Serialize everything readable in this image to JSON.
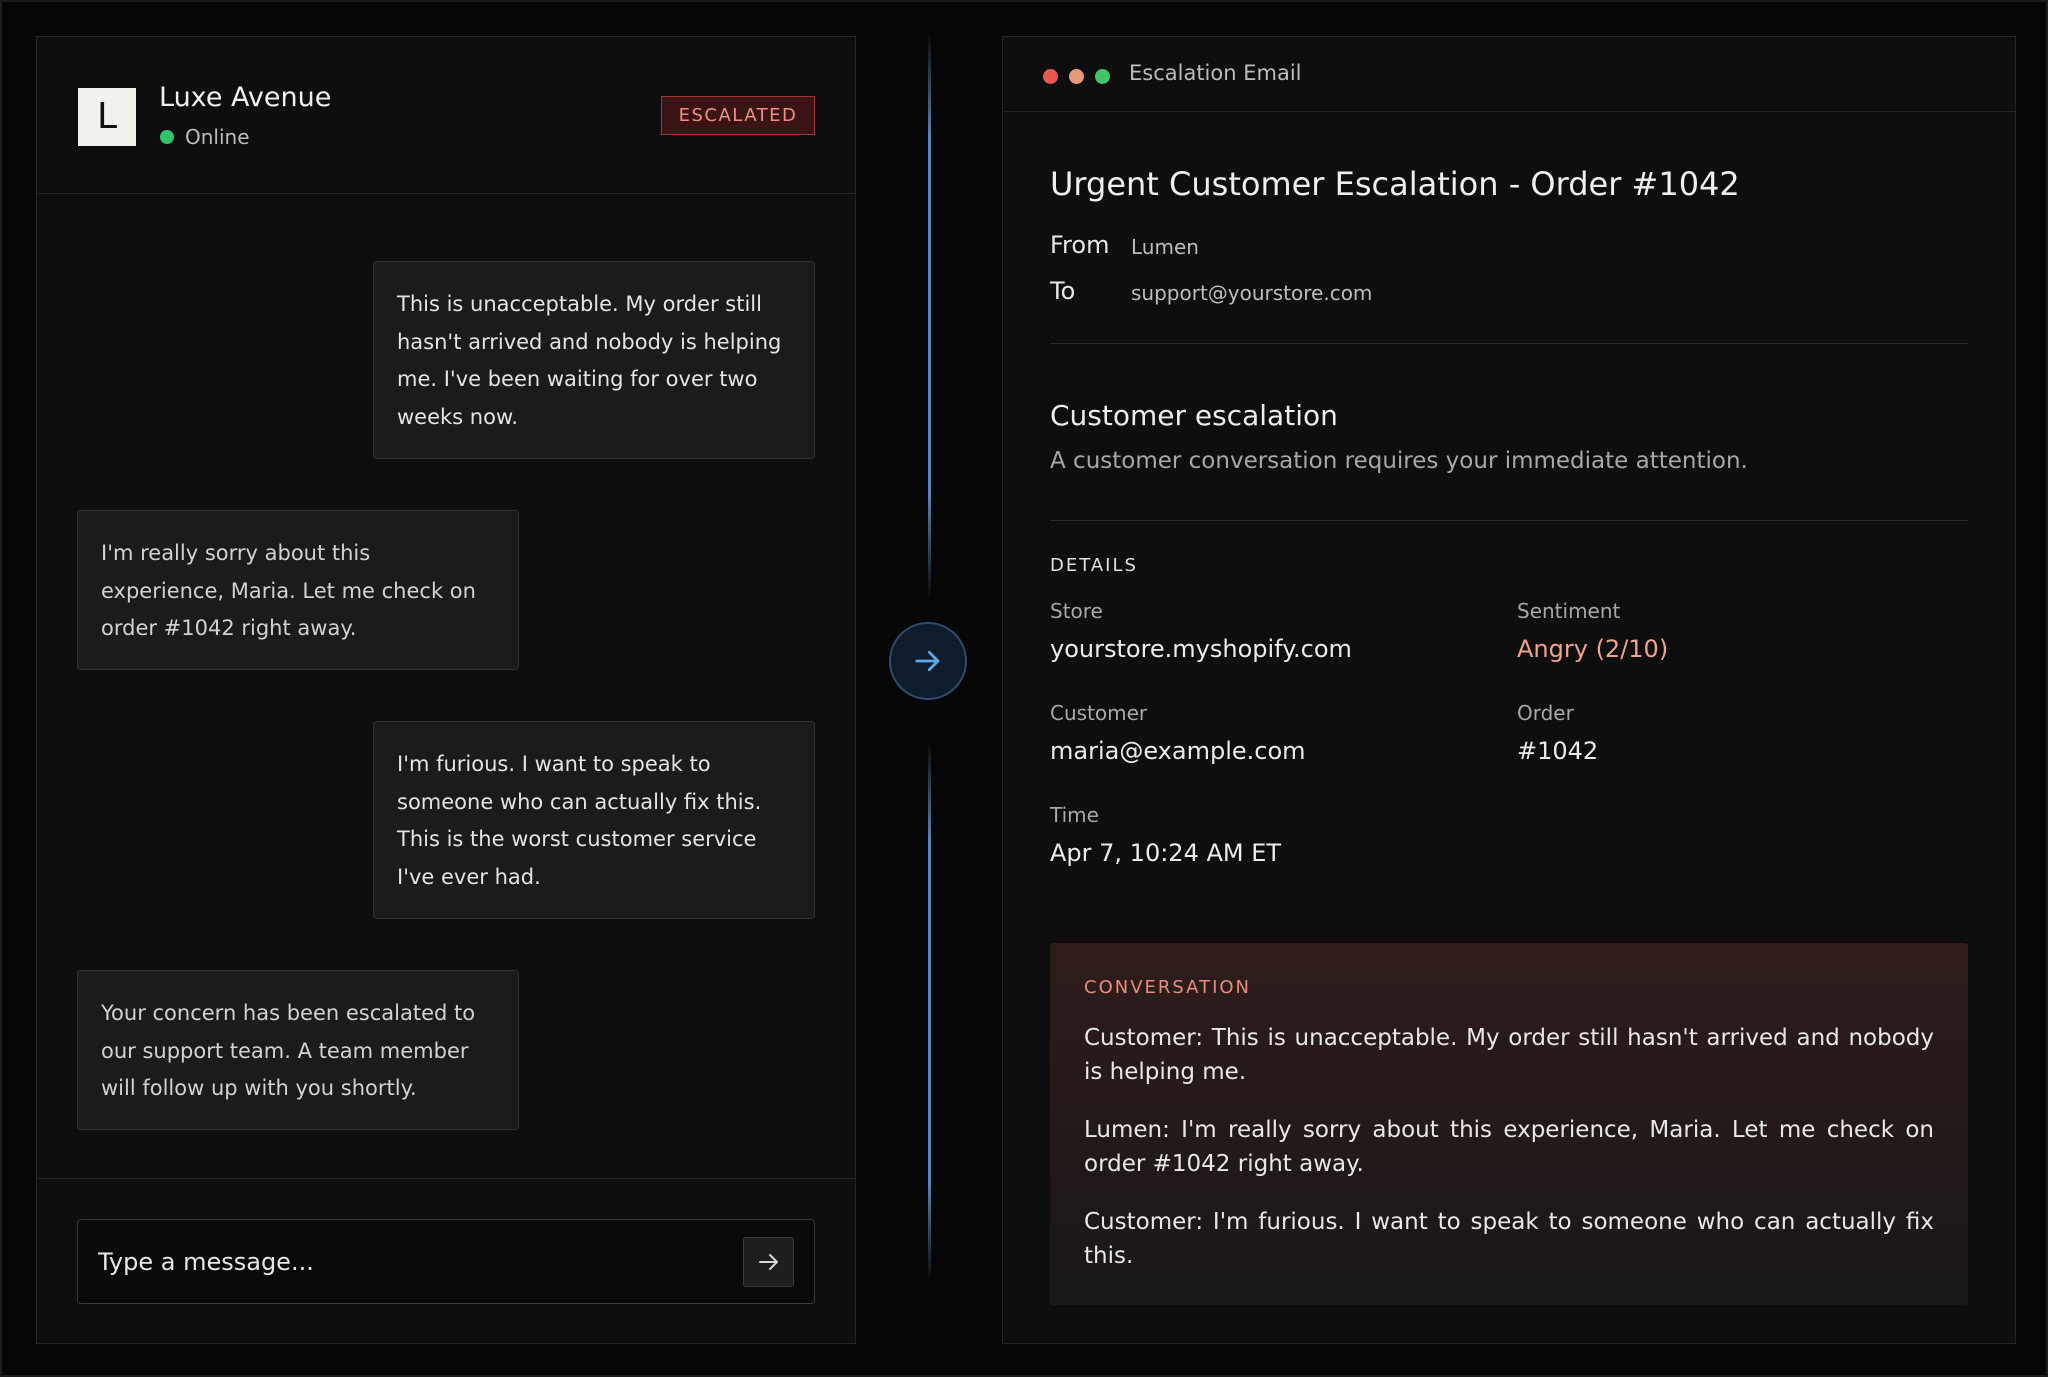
{
  "chat": {
    "avatar_letter": "L",
    "store_name": "Luxe Avenue",
    "status": "Online",
    "badge": "ESCALATED",
    "messages": [
      {
        "role": "customer",
        "text": "This is unacceptable. My order still hasn't arrived and nobody is helping me. I've been waiting for over two weeks now."
      },
      {
        "role": "assistant",
        "text": "I'm really sorry about this experience, Maria. Let me check on order #1042 right away."
      },
      {
        "role": "customer",
        "text": "I'm furious. I want to speak to someone who can actually fix this. This is the worst customer service I've ever had."
      },
      {
        "role": "assistant",
        "text": "Your concern has been escalated to our support team. A team member will follow up with you shortly."
      }
    ],
    "input_placeholder": "Type a message...",
    "send_icon": "arrow-right-icon"
  },
  "center_icon": "arrow-right-icon",
  "email": {
    "window_title": "Escalation Email",
    "subject": "Urgent Customer Escalation - Order #1042",
    "from_label": "From",
    "from_value": "Lumen",
    "to_label": "To",
    "to_value": "support@yourstore.com",
    "heading": "Customer escalation",
    "subheading": "A customer conversation requires your immediate attention.",
    "details_label": "DETAILS",
    "details": {
      "store_label": "Store",
      "store_value": "yourstore.myshopify.com",
      "sentiment_label": "Sentiment",
      "sentiment_value": "Angry (2/10)",
      "customer_label": "Customer",
      "customer_value": "maria@example.com",
      "order_label": "Order",
      "order_value": "#1042",
      "time_label": "Time",
      "time_value": "Apr 7, 10:24 AM ET"
    },
    "conversation_label": "CONVERSATION",
    "conversation": [
      "Customer: This is unacceptable. My order still hasn't arrived and nobody is helping me.",
      "Lumen: I'm really sorry about this experience, Maria. Let me check on order #1042 right away.",
      "Customer: I'm furious. I want to speak to someone who can actually fix this."
    ]
  },
  "colors": {
    "background": "#060606",
    "panel": "#0e0e0e",
    "badge_text": "#ec8f84",
    "status_online": "#33c46a",
    "sentiment_angry": "#f0a38d",
    "accent_blue": "#5a86b4"
  }
}
